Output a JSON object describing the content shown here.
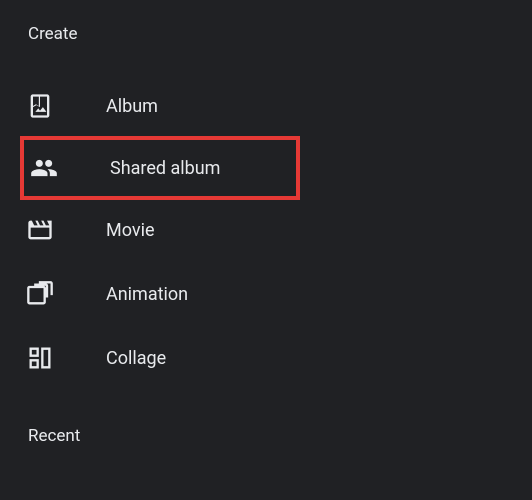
{
  "section": {
    "create_header": "Create",
    "recent_header": "Recent"
  },
  "menu": {
    "album": "Album",
    "shared_album": "Shared album",
    "movie": "Movie",
    "animation": "Animation",
    "collage": "Collage"
  }
}
